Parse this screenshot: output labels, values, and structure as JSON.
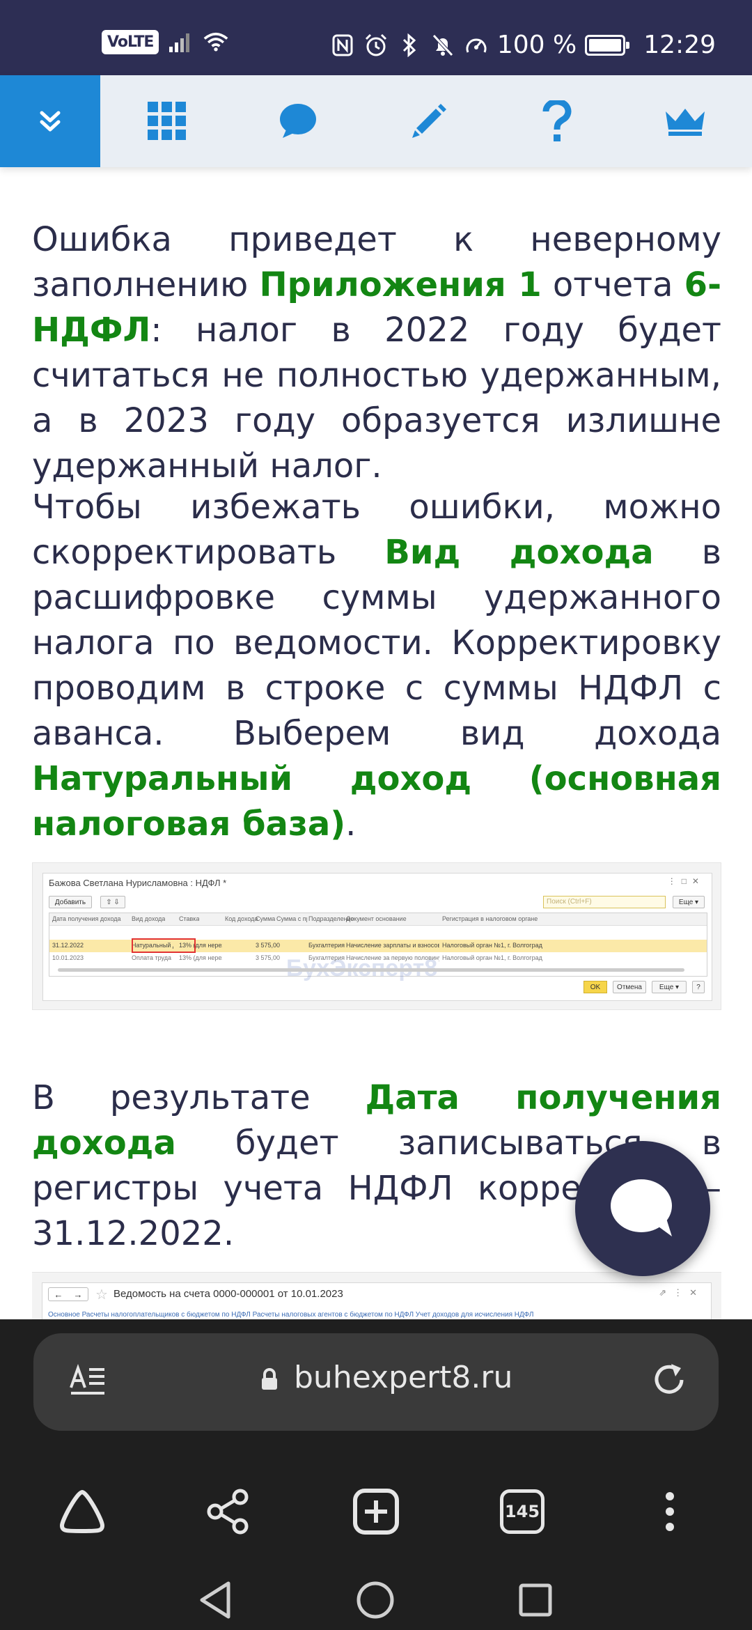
{
  "status_bar": {
    "volte": "VoLTE",
    "battery": "100 %",
    "time": "12:29"
  },
  "toolbar": {
    "items": [
      {
        "icon": "chevrons-down-icon"
      },
      {
        "icon": "grid-icon"
      },
      {
        "icon": "chat-icon"
      },
      {
        "icon": "pencil-icon"
      },
      {
        "icon": "question-icon"
      },
      {
        "icon": "crown-icon"
      }
    ],
    "colors": {
      "active_bg": "#1e88d6",
      "icon": "#1e88d6"
    }
  },
  "article": {
    "p1": {
      "t1": "Ошибка приведет к неверному заполнению ",
      "h1": "Приложения 1",
      "t2": " отчета ",
      "h2": "6-НДФЛ",
      "t3": ": налог в 2022 году будет считаться не полностью удержанным, а в 2023 году образуется излишне удержанный налог."
    },
    "p2": {
      "t1": "Чтобы избежать ошибки, можно скорректировать ",
      "h1": "Вид дохода",
      "t2": " в расшифровке суммы удержанного налога по ведомости. Корректировку проводим в строке с суммы НДФЛ с аванса. Выберем вид дохода ",
      "h2": "Натуральный доход (основная налоговая база)",
      "t3": "."
    },
    "p3": {
      "t1": "В результате ",
      "h1": "Дата получения дохода",
      "t2": " будет записываться в регистры учета НДФЛ корректно — 31.12.2022."
    }
  },
  "screenshot1": {
    "title": "Бажова Светлана Нурисламовна : НДФЛ *",
    "add_button": "Добавить",
    "search_placeholder": "Поиск (Ctrl+F)",
    "more_button": "Еще ▾",
    "columns": [
      "Дата получения дохода",
      "Вид дохода",
      "Ставка",
      "Код дохода",
      "Сумма",
      "Сумма с превышения",
      "Подразделение",
      "Документ основание",
      "Регистрация в налоговом органе"
    ],
    "rows": [
      [
        "31.12.2022",
        "Натуральный дохо...",
        "13% (для нерезид...",
        "",
        "3 575,00",
        "",
        "Бухгалтерия",
        "Начисление зарплаты и взносов 0000-00000...",
        "Налоговый орган №1, г. Волгоград"
      ],
      [
        "10.01.2023",
        "Оплата труда (осн...",
        "13% (для нерезид...",
        "",
        "3 575,00",
        "",
        "Бухгалтерия",
        "Начисление за первую половину месяца 00...",
        "Налоговый орган №1, г. Волгоград"
      ]
    ],
    "watermark": "БухЭксперт8",
    "ok_button": "OK",
    "cancel_button": "Отмена",
    "more_button2": "Еще ▾",
    "help_button": "?"
  },
  "screenshot2": {
    "title": "Ведомость на счета 0000-000001 от 10.01.2023",
    "links": "Основное    Расчеты налогоплательщиков с бюджетом по НДФЛ    Расчеты налоговых агентов с бюджетом по НДФЛ    Учет доходов для исчисления НДФЛ"
  },
  "browser": {
    "url": "buhexpert8.ru",
    "tab_count": "145"
  }
}
